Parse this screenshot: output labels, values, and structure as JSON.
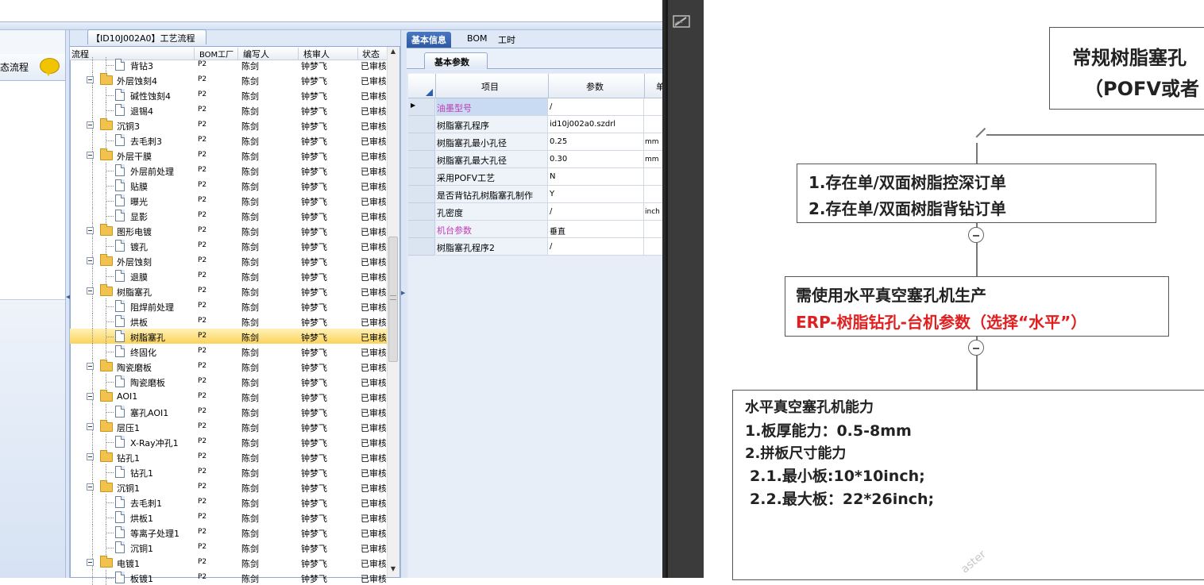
{
  "process_panel": {
    "title": "【ID10J002A0】工艺流程",
    "columns": [
      "流程",
      "BOM工厂",
      "编写人",
      "核审人",
      "状态"
    ]
  },
  "nav": {
    "label": "态流程"
  },
  "tree_rows": [
    {
      "name": "背钻3",
      "level": 2,
      "factory": "P2",
      "writer": "陈剑",
      "reviewer": "钟梦飞",
      "status": "已审核"
    },
    {
      "name": "外层蚀刻4",
      "level": 1,
      "factory": "P2",
      "writer": "陈剑",
      "reviewer": "钟梦飞",
      "status": "已审核"
    },
    {
      "name": "碱性蚀刻4",
      "level": 2,
      "factory": "P2",
      "writer": "陈剑",
      "reviewer": "钟梦飞",
      "status": "已审核"
    },
    {
      "name": "退锡4",
      "level": 2,
      "factory": "P2",
      "writer": "陈剑",
      "reviewer": "钟梦飞",
      "status": "已审核"
    },
    {
      "name": "沉铜3",
      "level": 1,
      "factory": "P2",
      "writer": "陈剑",
      "reviewer": "钟梦飞",
      "status": "已审核"
    },
    {
      "name": "去毛刺3",
      "level": 2,
      "factory": "P2",
      "writer": "陈剑",
      "reviewer": "钟梦飞",
      "status": "已审核"
    },
    {
      "name": "外层干膜",
      "level": 1,
      "factory": "P2",
      "writer": "陈剑",
      "reviewer": "钟梦飞",
      "status": "已审核"
    },
    {
      "name": "外层前处理",
      "level": 2,
      "factory": "P2",
      "writer": "陈剑",
      "reviewer": "钟梦飞",
      "status": "已审核"
    },
    {
      "name": "贴膜",
      "level": 2,
      "factory": "P2",
      "writer": "陈剑",
      "reviewer": "钟梦飞",
      "status": "已审核"
    },
    {
      "name": "曝光",
      "level": 2,
      "factory": "P2",
      "writer": "陈剑",
      "reviewer": "钟梦飞",
      "status": "已审核"
    },
    {
      "name": "显影",
      "level": 2,
      "factory": "P2",
      "writer": "陈剑",
      "reviewer": "钟梦飞",
      "status": "已审核"
    },
    {
      "name": "图形电镀",
      "level": 1,
      "factory": "P2",
      "writer": "陈剑",
      "reviewer": "钟梦飞",
      "status": "已审核"
    },
    {
      "name": "镀孔",
      "level": 2,
      "factory": "P2",
      "writer": "陈剑",
      "reviewer": "钟梦飞",
      "status": "已审核"
    },
    {
      "name": "外层蚀刻",
      "level": 1,
      "factory": "P2",
      "writer": "陈剑",
      "reviewer": "钟梦飞",
      "status": "已审核"
    },
    {
      "name": "退膜",
      "level": 2,
      "factory": "P2",
      "writer": "陈剑",
      "reviewer": "钟梦飞",
      "status": "已审核"
    },
    {
      "name": "树脂塞孔",
      "level": 1,
      "factory": "P2",
      "writer": "陈剑",
      "reviewer": "钟梦飞",
      "status": "已审核"
    },
    {
      "name": "阻焊前处理",
      "level": 2,
      "factory": "P2",
      "writer": "陈剑",
      "reviewer": "钟梦飞",
      "status": "已审核"
    },
    {
      "name": "烘板",
      "level": 2,
      "factory": "P2",
      "writer": "陈剑",
      "reviewer": "钟梦飞",
      "status": "已审核"
    },
    {
      "name": "树脂塞孔",
      "level": 2,
      "factory": "P2",
      "writer": "陈剑",
      "reviewer": "钟梦飞",
      "status": "已审核",
      "selected": true
    },
    {
      "name": "终固化",
      "level": 2,
      "factory": "P2",
      "writer": "陈剑",
      "reviewer": "钟梦飞",
      "status": "已审核"
    },
    {
      "name": "陶瓷磨板",
      "level": 1,
      "factory": "P2",
      "writer": "陈剑",
      "reviewer": "钟梦飞",
      "status": "已审核"
    },
    {
      "name": "陶瓷磨板",
      "level": 2,
      "factory": "P2",
      "writer": "陈剑",
      "reviewer": "钟梦飞",
      "status": "已审核"
    },
    {
      "name": "AOI1",
      "level": 1,
      "factory": "P2",
      "writer": "陈剑",
      "reviewer": "钟梦飞",
      "status": "已审核"
    },
    {
      "name": "塞孔AOI1",
      "level": 2,
      "factory": "P2",
      "writer": "陈剑",
      "reviewer": "钟梦飞",
      "status": "已审核"
    },
    {
      "name": "层压1",
      "level": 1,
      "factory": "P2",
      "writer": "陈剑",
      "reviewer": "钟梦飞",
      "status": "已审核"
    },
    {
      "name": "X-Ray冲孔1",
      "level": 2,
      "factory": "P2",
      "writer": "陈剑",
      "reviewer": "钟梦飞",
      "status": "已审核"
    },
    {
      "name": "钻孔1",
      "level": 1,
      "factory": "P2",
      "writer": "陈剑",
      "reviewer": "钟梦飞",
      "status": "已审核"
    },
    {
      "name": "钻孔1",
      "level": 2,
      "factory": "P2",
      "writer": "陈剑",
      "reviewer": "钟梦飞",
      "status": "已审核"
    },
    {
      "name": "沉铜1",
      "level": 1,
      "factory": "P2",
      "writer": "陈剑",
      "reviewer": "钟梦飞",
      "status": "已审核"
    },
    {
      "name": "去毛刺1",
      "level": 2,
      "factory": "P2",
      "writer": "陈剑",
      "reviewer": "钟梦飞",
      "status": "已审核"
    },
    {
      "name": "烘板1",
      "level": 2,
      "factory": "P2",
      "writer": "陈剑",
      "reviewer": "钟梦飞",
      "status": "已审核"
    },
    {
      "name": "等离子处理1",
      "level": 2,
      "factory": "P2",
      "writer": "陈剑",
      "reviewer": "钟梦飞",
      "status": "已审核"
    },
    {
      "name": "沉铜1",
      "level": 2,
      "factory": "P2",
      "writer": "陈剑",
      "reviewer": "钟梦飞",
      "status": "已审核"
    },
    {
      "name": "电镀1",
      "level": 1,
      "factory": "P2",
      "writer": "陈剑",
      "reviewer": "钟梦飞",
      "status": "已审核"
    },
    {
      "name": "板镀1",
      "level": 2,
      "factory": "P2",
      "writer": "陈剑",
      "reviewer": "钟梦飞",
      "status": "已审核"
    }
  ],
  "detail": {
    "tabs": [
      "基本信息",
      "BOM",
      "工时"
    ],
    "active_tab": 0,
    "sub_tab": "基本参数",
    "columns": [
      "项目",
      "参数",
      "单"
    ],
    "rows": [
      {
        "item": "油墨型号",
        "value": "/",
        "unit": "",
        "highlight": true
      },
      {
        "item": "树脂塞孔程序",
        "value": "id10j002a0.szdrl",
        "unit": ""
      },
      {
        "item": "树脂塞孔最小孔径",
        "value": "0.25",
        "unit": "mm"
      },
      {
        "item": "树脂塞孔最大孔径",
        "value": "0.30",
        "unit": "mm"
      },
      {
        "item": "采用POFV工艺",
        "value": "N",
        "unit": ""
      },
      {
        "item": "是否背钻孔树脂塞孔制作",
        "value": "Y",
        "unit": ""
      },
      {
        "item": "孔密度",
        "value": "/",
        "unit": "inch"
      },
      {
        "item": "机台参数",
        "value": "垂直",
        "unit": "",
        "highlight": true
      },
      {
        "item": "树脂塞孔程序2",
        "value": "/",
        "unit": ""
      }
    ]
  },
  "mindmap": {
    "root": [
      "常规树脂塞孔",
      "（POFV或者"
    ],
    "node1": [
      "1.存在单/双面树脂控深订单",
      "2.存在单/双面树脂背钻订单"
    ],
    "node2_line1": "需使用水平真空塞孔机生产",
    "node2_line2": "ERP-树脂钻孔-台机参数（选择“水平”）",
    "node3": [
      "水平真空塞孔机能力",
      "1.板厚能力：0.5-8mm",
      "2.拼板尺寸能力",
      "2.1.最小板:10*10inch;",
      "2.2.最大板：22*26inch;"
    ],
    "watermark": "aster",
    "accent_color": "#e02020"
  }
}
